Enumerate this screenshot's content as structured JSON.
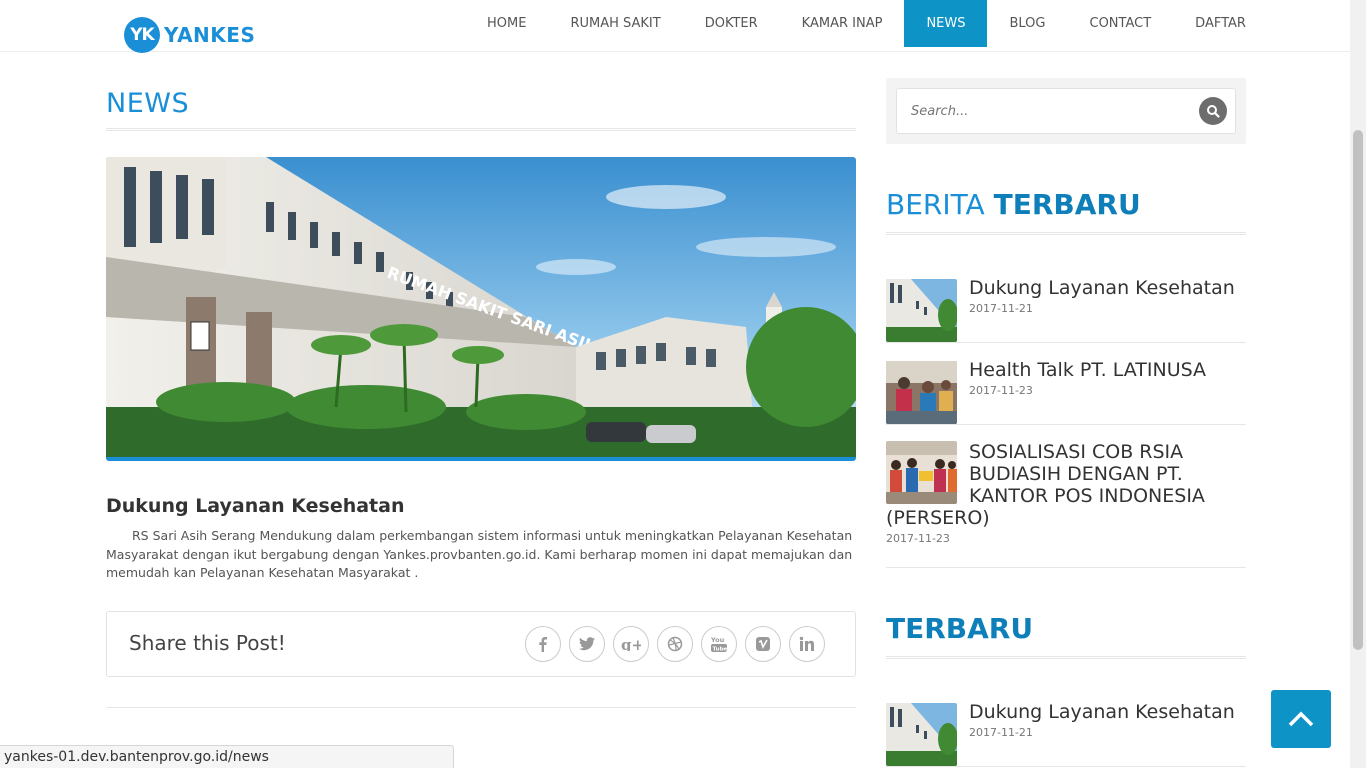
{
  "logo": {
    "badge": "YK",
    "text": "YANKES"
  },
  "nav": [
    {
      "label": "HOME"
    },
    {
      "label": "RUMAH SAKIT"
    },
    {
      "label": "DOKTER"
    },
    {
      "label": "KAMAR INAP"
    },
    {
      "label": "NEWS",
      "active": true
    },
    {
      "label": "BLOG"
    },
    {
      "label": "CONTACT"
    },
    {
      "label": "DAFTAR"
    }
  ],
  "page_title": "NEWS",
  "hero": {
    "building_sign": "RUMAH SAKIT SARI ASIH SERANG"
  },
  "post": {
    "title": "Dukung Layanan Kesehatan",
    "body": "RS Sari Asih Serang Mendukung dalam perkembangan sistem informasi untuk meningkatkan Pelayanan Kesehatan Masyarakat dengan ikut bergabung dengan Yankes.provbanten.go.id. Kami berharap momen ini dapat memajukan dan memudah kan Pelayanan Kesehatan Masyarakat ."
  },
  "share": {
    "label": "Share this Post!",
    "icons": [
      "facebook-icon",
      "twitter-icon",
      "google-plus-icon",
      "dribbble-icon",
      "youtube-icon",
      "vimeo-icon",
      "linkedin-icon"
    ]
  },
  "search": {
    "placeholder": "Search..."
  },
  "berita_terbaru": {
    "title_light": "BERITA",
    "title_bold": "TERBARU",
    "items": [
      {
        "title": "Dukung Layanan Kesehatan",
        "date": "2017-11-21"
      },
      {
        "title": "Health Talk PT. LATINUSA",
        "date": "2017-11-23"
      },
      {
        "title": "SOSIALISASI COB RSIA BUDIASIH DENGAN PT. KANTOR POS INDONESIA (PERSERO)",
        "date": "2017-11-23"
      }
    ]
  },
  "terbaru": {
    "title": "TERBARU",
    "items": [
      {
        "title": "Dukung Layanan Kesehatan",
        "date": "2017-11-21"
      }
    ]
  },
  "status_bar": {
    "url": "yankes-01.dev.bantenprov.go.id/news"
  },
  "colors": {
    "accent": "#1a8fd8",
    "nav_active": "#0e93c6"
  }
}
